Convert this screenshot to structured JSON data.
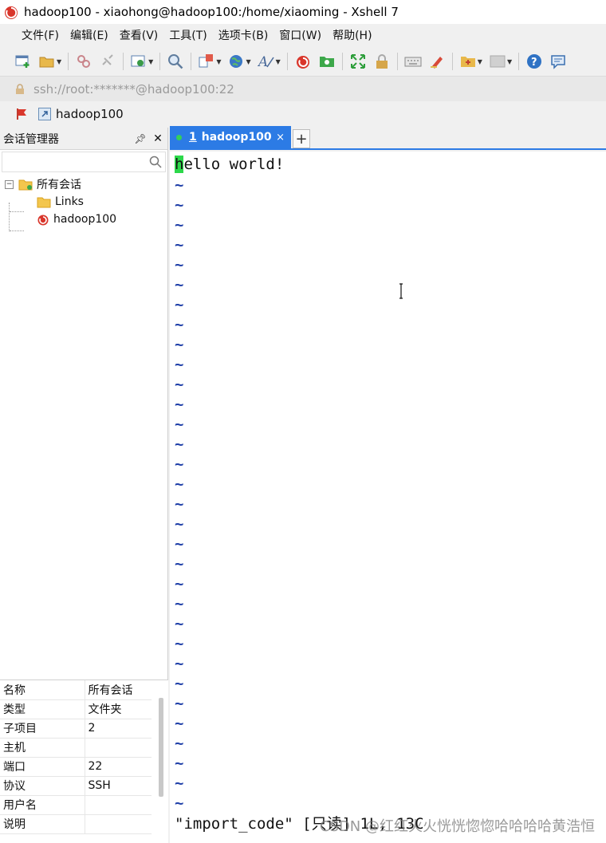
{
  "window": {
    "title": "hadoop100 - xiaohong@hadoop100:/home/xiaoming - Xshell 7"
  },
  "menu": [
    {
      "label": "文件(F)"
    },
    {
      "label": "编辑(E)"
    },
    {
      "label": "查看(V)"
    },
    {
      "label": "工具(T)"
    },
    {
      "label": "选项卡(B)"
    },
    {
      "label": "窗口(W)"
    },
    {
      "label": "帮助(H)"
    }
  ],
  "toolbar": {
    "icons": [
      "new-session-icon",
      "open-folder-icon",
      "connect-icon",
      "disconnect-icon",
      "properties-icon",
      "find-icon",
      "transfer-icon",
      "globe-icon",
      "font-icon",
      "xshell-icon",
      "xftp-icon",
      "fullscreen-icon",
      "lock-icon",
      "keyboard-icon",
      "highlight-icon",
      "new-tab-icon",
      "layout-icon",
      "help-icon",
      "chat-icon"
    ]
  },
  "address": {
    "text": "ssh://root:*******@hadoop100:22"
  },
  "quickbar": {
    "link_label": "hadoop100"
  },
  "session_manager": {
    "title": "会话管理器",
    "search_placeholder": "",
    "tree": {
      "root": "所有会话",
      "children": [
        "Links",
        "hadoop100"
      ]
    }
  },
  "properties": {
    "rows": [
      {
        "key": "名称",
        "value": "所有会话"
      },
      {
        "key": "类型",
        "value": "文件夹"
      },
      {
        "key": "子项目",
        "value": "2"
      },
      {
        "key": "主机",
        "value": ""
      },
      {
        "key": "端口",
        "value": "22"
      },
      {
        "key": "协议",
        "value": "SSH"
      },
      {
        "key": "用户名",
        "value": ""
      },
      {
        "key": "说明",
        "value": ""
      }
    ]
  },
  "tab": {
    "number": "1",
    "label": "hadoop100",
    "close": "×",
    "add": "+"
  },
  "terminal": {
    "first_char": "h",
    "first_line_rest": "ello world!",
    "tilde": "~",
    "tilde_count": 32,
    "status_line": "\"import_code\" [只读] 1L, 13C"
  },
  "watermark": "CSDN @红红火火恍恍惚惚哈哈哈哈黄浩恒",
  "colors": {
    "tab_blue": "#2c7be5",
    "cursor_green": "#2cd84a",
    "tilde_blue": "#1f3fa8"
  }
}
